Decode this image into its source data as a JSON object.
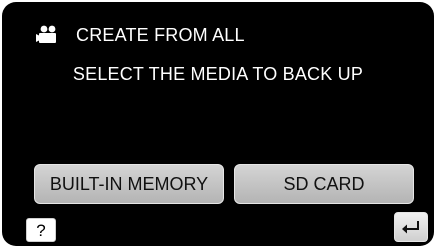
{
  "header": {
    "icon": "video-camera-icon",
    "title": "CREATE FROM ALL"
  },
  "prompt": "SELECT THE MEDIA TO BACK UP",
  "media_options": [
    {
      "label": "BUILT-IN MEMORY"
    },
    {
      "label": "SD CARD"
    }
  ],
  "help_button": {
    "label": "?",
    "icon": "help-icon"
  },
  "back_button": {
    "icon": "return-arrow-icon"
  },
  "colors": {
    "screen_background": "#000000",
    "text": "#ffffff",
    "button_face": "#c4c4c4",
    "button_text": "#111111"
  }
}
